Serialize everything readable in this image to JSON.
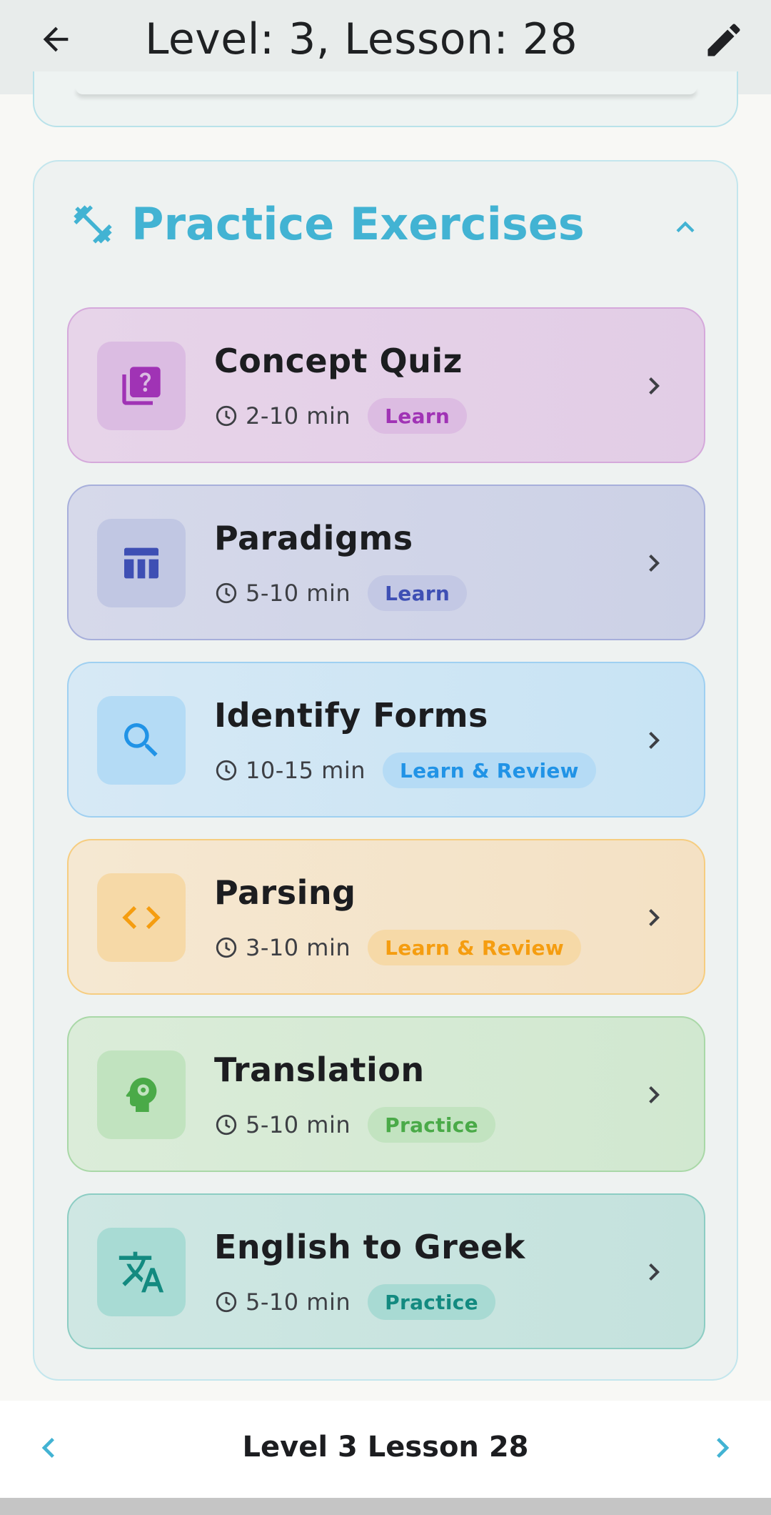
{
  "appbar": {
    "title": "Level: 3, Lesson: 28",
    "back_icon": "arrow-back-icon",
    "edit_icon": "pencil-icon"
  },
  "section": {
    "title": "Practice Exercises",
    "icon": "dumbbell-icon",
    "accent_color": "#42b3d3",
    "expanded": true
  },
  "exercises": [
    {
      "name": "Concept Quiz",
      "duration": "2-10 min",
      "badge": "Learn",
      "icon": "quiz-icon",
      "color": "#a033b5"
    },
    {
      "name": "Paradigms",
      "duration": "5-10 min",
      "badge": "Learn",
      "icon": "table-icon",
      "color": "#3e4fb4"
    },
    {
      "name": "Identify Forms",
      "duration": "10-15 min",
      "badge": "Learn & Review",
      "icon": "search-icon",
      "color": "#2193e6"
    },
    {
      "name": "Parsing",
      "duration": "3-10 min",
      "badge": "Learn & Review",
      "icon": "code-icon",
      "color": "#f59d10"
    },
    {
      "name": "Translation",
      "duration": "5-10 min",
      "badge": "Practice",
      "icon": "head-gear-icon",
      "color": "#4aaa48"
    },
    {
      "name": "English to Greek",
      "duration": "5-10 min",
      "badge": "Practice",
      "icon": "translate-icon",
      "color": "#138a80"
    }
  ],
  "bottom_nav": {
    "label": "Level 3 Lesson 28",
    "prev_icon": "chevron-left-icon",
    "next_icon": "chevron-right-icon"
  }
}
